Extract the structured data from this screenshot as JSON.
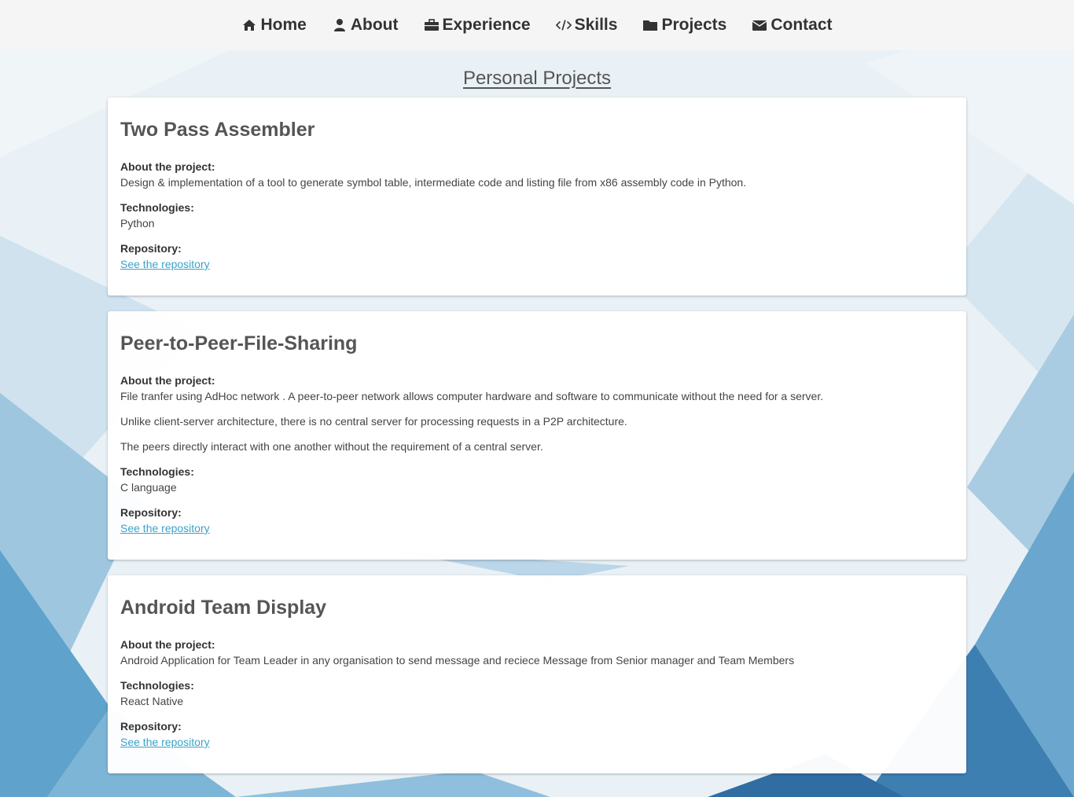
{
  "nav": {
    "items": [
      {
        "label": "Home",
        "icon": "home-icon"
      },
      {
        "label": "About",
        "icon": "user-icon"
      },
      {
        "label": "Experience",
        "icon": "briefcase-icon"
      },
      {
        "label": "Skills",
        "icon": "code-icon"
      },
      {
        "label": "Projects",
        "icon": "folder-icon"
      },
      {
        "label": "Contact",
        "icon": "envelope-icon"
      }
    ]
  },
  "section": {
    "title": "Personal Projects"
  },
  "labels": {
    "about": "About the project:",
    "technologies": "Technologies:",
    "repository": "Repository:",
    "repo_link": "See the repository"
  },
  "projects": [
    {
      "title": "Two Pass Assembler",
      "about": [
        "Design & implementation of a tool to generate symbol table, intermediate code and listing file from x86 assembly code in Python."
      ],
      "technologies": "Python"
    },
    {
      "title": "Peer-to-Peer-File-Sharing",
      "about": [
        "File tranfer using AdHoc network . A peer-to-peer network allows computer hardware and software to communicate without the need for a server.",
        "Unlike client-server architecture, there is no central server for processing requests in a P2P architecture.",
        "The peers directly interact with one another without the requirement of a central server."
      ],
      "technologies": "C language"
    },
    {
      "title": "Android Team Display",
      "about": [
        "Android Application for Team Leader in any organisation to send message and reciece Message from Senior manager and Team Members"
      ],
      "technologies": "React Native"
    }
  ],
  "colors": {
    "link": "#3aa3c9",
    "navbar_bg": "#f5f5f5",
    "bg_accent": "#3b7fb3"
  }
}
